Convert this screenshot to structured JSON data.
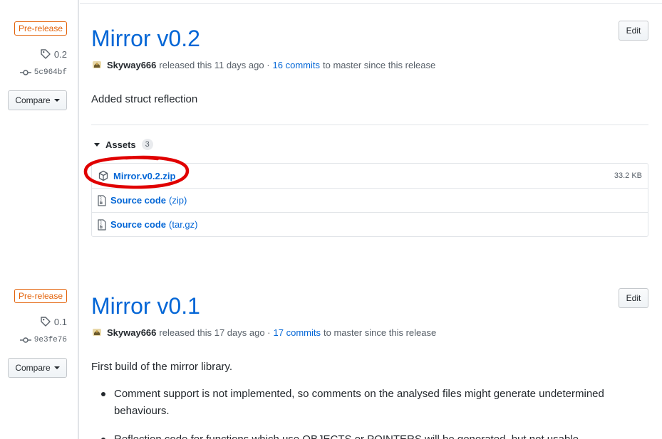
{
  "releases": [
    {
      "badge": "Pre-release",
      "tag": "0.2",
      "commit": "5c964bf",
      "compare_label": "Compare",
      "title": "Mirror v0.2",
      "edit_label": "Edit",
      "author": "Skyway666",
      "released_text": "released this 11 days ago ·",
      "commits_link": "16 commits",
      "commits_suffix": "to master since this release",
      "description": "Added struct reflection",
      "assets_label": "Assets",
      "assets_count": "3",
      "assets": [
        {
          "name": "Mirror.v0.2.zip",
          "size": "33.2 KB",
          "icon": "package-icon",
          "highlighted": true
        },
        {
          "name": "Source code",
          "sub": "(zip)",
          "icon": "file-zip-icon"
        },
        {
          "name": "Source code",
          "sub": "(tar.gz)",
          "icon": "file-zip-icon"
        }
      ]
    },
    {
      "badge": "Pre-release",
      "tag": "0.1",
      "commit": "9e3fe76",
      "compare_label": "Compare",
      "title": "Mirror v0.1",
      "edit_label": "Edit",
      "author": "Skyway666",
      "released_text": "released this 17 days ago ·",
      "commits_link": "17 commits",
      "commits_suffix": "to master since this release",
      "description": "First build of the mirror library.",
      "notes": [
        "Comment support is not implemented, so comments on the analysed files might generate undetermined behaviours.",
        "Reflection code for functions which use OBJECTS or POINTERS will be generated, but not usable."
      ]
    }
  ],
  "colors": {
    "link": "#0366d6",
    "prerelease": "#e36209",
    "annotation": "#e00000"
  }
}
